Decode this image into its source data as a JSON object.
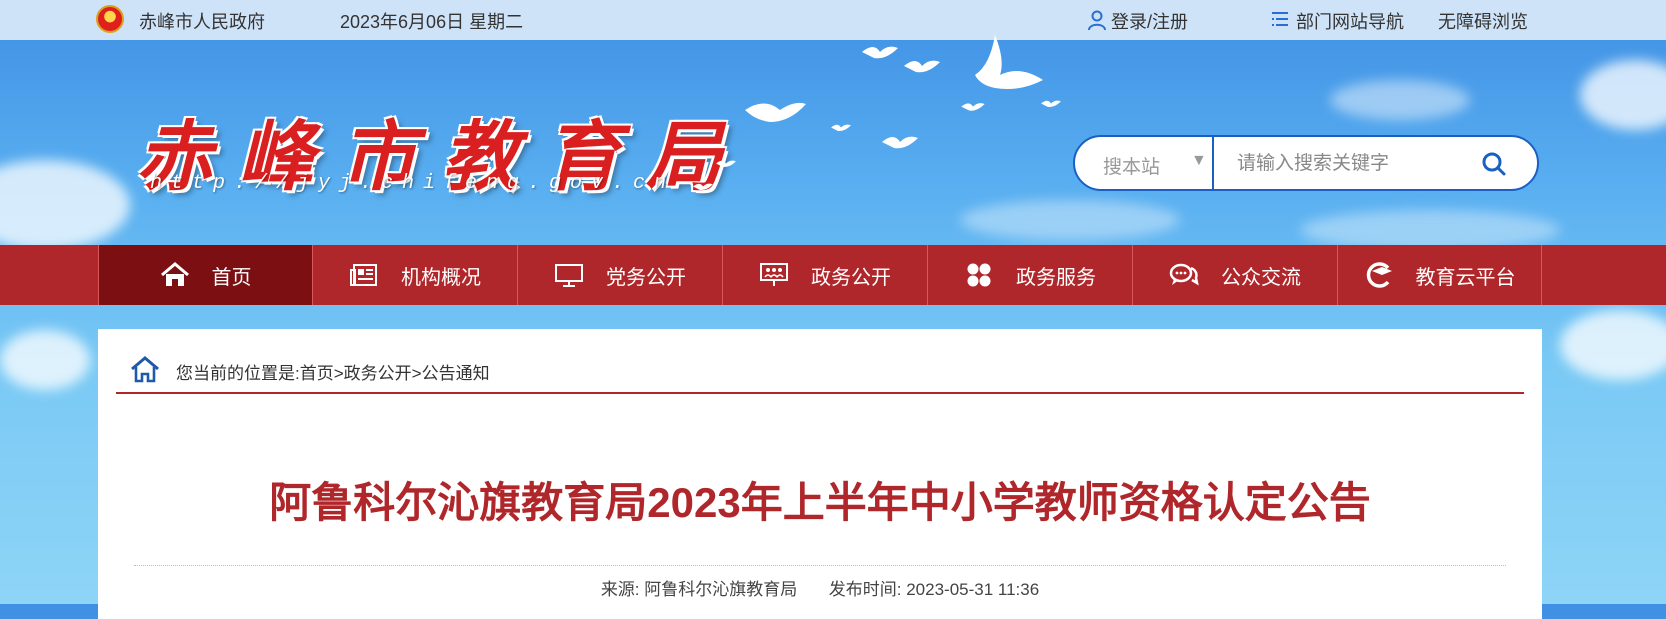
{
  "topbar": {
    "site_name": "赤峰市人民政府",
    "date": "2023年6月06日 星期二",
    "login": "登录/注册",
    "dept_nav": "部门网站导航",
    "accessibility": "无障碍浏览"
  },
  "header": {
    "logo_title": "赤峰市教育局",
    "logo_url": "http://jyj.chifeng.gov.cn"
  },
  "search": {
    "scope": "搜本站",
    "placeholder": "请输入搜索关键字"
  },
  "nav": {
    "items": [
      {
        "label": "首页"
      },
      {
        "label": "机构概况"
      },
      {
        "label": "党务公开"
      },
      {
        "label": "政务公开"
      },
      {
        "label": "政务服务"
      },
      {
        "label": "公众交流"
      },
      {
        "label": "教育云平台"
      }
    ]
  },
  "breadcrumb": {
    "prefix": "您当前的位置是:",
    "items": [
      "首页",
      "政务公开",
      "公告通知"
    ],
    "separator": ">"
  },
  "article": {
    "title": "阿鲁科尔沁旗教育局2023年上半年中小学教师资格认定公告",
    "source_label": "来源:",
    "source": "阿鲁科尔沁旗教育局",
    "time_label": "发布时间:",
    "time": "2023-05-31 11:36"
  },
  "colors": {
    "nav_red": "#b0272b",
    "nav_active": "#7b0f12",
    "title_red": "#b0272b",
    "search_border": "#1a5fc4"
  }
}
